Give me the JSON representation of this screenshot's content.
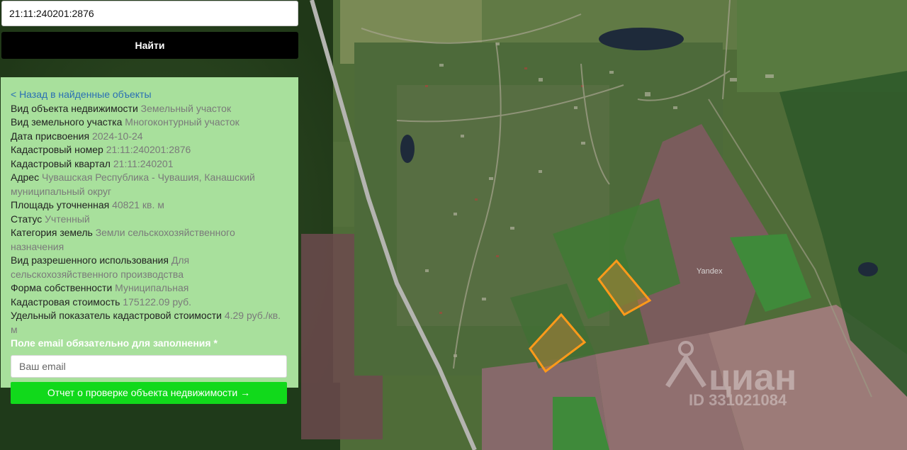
{
  "search": {
    "value": "21:11:240201:2876",
    "button_label": "Найти"
  },
  "panel": {
    "back_link": "< Назад в найденные объекты",
    "fields": [
      {
        "label": "Вид объекта недвижимости",
        "value": "Земельный участок"
      },
      {
        "label": "Вид земельного участка",
        "value": "Многоконтурный участок"
      },
      {
        "label": "Дата присвоения",
        "value": "2024-10-24"
      },
      {
        "label": "Кадастровый номер",
        "value": "21:11:240201:2876"
      },
      {
        "label": "Кадастровый квартал",
        "value": "21:11:240201"
      },
      {
        "label": "Адрес",
        "value": "Чувашская Республика - Чувашия, Канашский муниципальный округ"
      },
      {
        "label": "Площадь уточненная",
        "value": "40821 кв. м"
      },
      {
        "label": "Статус",
        "value": "Учтенный"
      },
      {
        "label": "Категория земель",
        "value": "Земли сельскохозяйственного назначения"
      },
      {
        "label": "Вид разрешенного использования",
        "value": "Для сельскохозяйственного производства"
      },
      {
        "label": "Форма собственности",
        "value": "Муниципальная"
      },
      {
        "label": "Кадастровая стоимость",
        "value": "175122.09 руб."
      },
      {
        "label": "Удельный показатель кадастровой стоимости",
        "value": "4.29 руб./кв. м"
      }
    ],
    "email_note": "Поле email обязательно для заполнения *",
    "email_placeholder": "Ваш email",
    "report_button": "Отчет о проверке объекта недвижимости →"
  },
  "map": {
    "provider_label": "Yandex",
    "watermark_brand": "циан",
    "watermark_id": "ID 331021084",
    "colors": {
      "parcel_outline": "#ff9a1a",
      "road": "#b4b4b0"
    }
  }
}
